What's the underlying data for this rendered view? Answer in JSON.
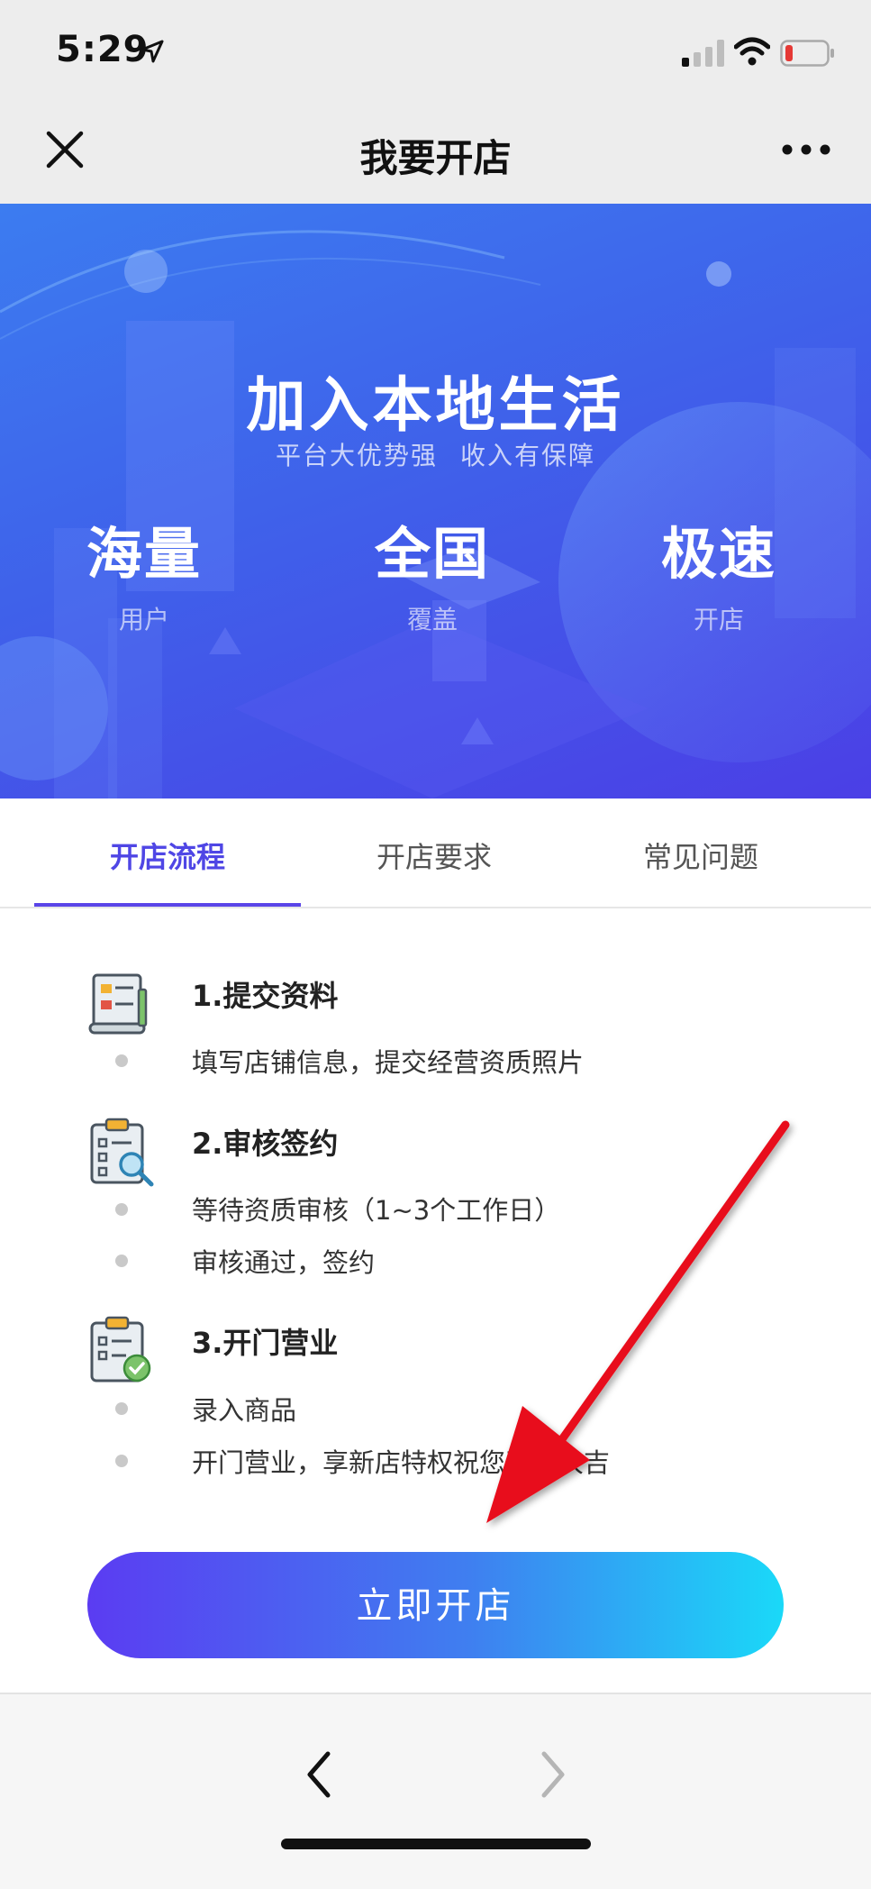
{
  "status_bar": {
    "time": "5:29",
    "icons": [
      "location-arrow-icon",
      "cellular-signal-icon",
      "wifi-icon",
      "battery-low-icon"
    ],
    "battery_color": "#e53935"
  },
  "nav": {
    "title": "我要开店",
    "close_icon": "close-icon",
    "more_icon": "more-icon"
  },
  "hero": {
    "title": "加入本地生活",
    "subtitle": "平台大优势强 收入有保障",
    "features": [
      {
        "big": "海量",
        "small": "用户"
      },
      {
        "big": "全国",
        "small": "覆盖"
      },
      {
        "big": "极速",
        "small": "开店"
      }
    ]
  },
  "tabs": [
    {
      "label": "开店流程",
      "active": true
    },
    {
      "label": "开店要求",
      "active": false
    },
    {
      "label": "常见问题",
      "active": false
    }
  ],
  "steps": [
    {
      "title": "1.提交资料",
      "icon": "document-form-icon",
      "items": [
        "填写店铺信息，提交经营资质照片"
      ]
    },
    {
      "title": "2.审核签约",
      "icon": "clipboard-search-icon",
      "items": [
        "等待资质审核（1~3个工作日）",
        "审核通过，签约"
      ]
    },
    {
      "title": "3.开门营业",
      "icon": "clipboard-check-icon",
      "items": [
        "录入商品",
        "开门营业，享新店特权祝您开门大吉"
      ]
    }
  ],
  "cta": {
    "label": "立即开店"
  },
  "toolbar": {
    "back_icon": "chevron-left-icon",
    "forward_icon": "chevron-right-icon"
  },
  "colors": {
    "accent": "#4f46e5",
    "hero_start": "#3c7cf0",
    "hero_end": "#4b3fe6",
    "cta_start": "#5b3cf2",
    "cta_end": "#1ad9f8",
    "annotation_arrow": "#e8111b"
  }
}
